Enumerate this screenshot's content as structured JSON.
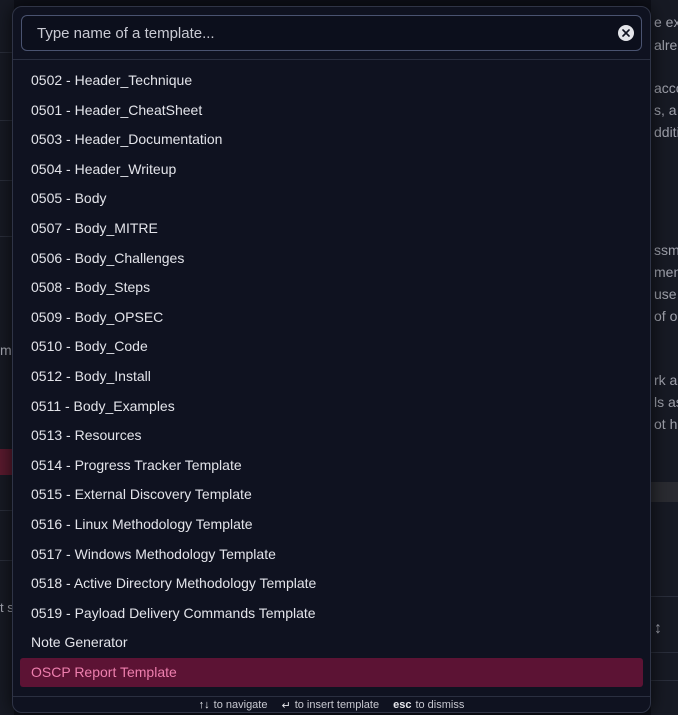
{
  "background": {
    "left_text_m": "m",
    "left_text_t": "t s",
    "right_fragments": [
      "e exp",
      "alrea",
      "acco",
      "s, a",
      "dditi",
      "ssme",
      "men",
      "use",
      "of o",
      "rk ar",
      "ls as",
      "ot ha"
    ]
  },
  "search": {
    "placeholder": "Type name of a template...",
    "value": ""
  },
  "templates": [
    "0502 - Header_Technique",
    "0501 - Header_CheatSheet",
    "0503 - Header_Documentation",
    "0504 - Header_Writeup",
    "0505 - Body",
    "0507 - Body_MITRE",
    "0506 - Body_Challenges",
    "0508 - Body_Steps",
    "0509 - Body_OPSEC",
    "0510 - Body_Code",
    "0512 - Body_Install",
    "0511 - Body_Examples",
    "0513 - Resources",
    "0514 - Progress Tracker Template",
    "0515 - External Discovery Template",
    "0516 - Linux Methodology Template",
    "0517 - Windows Methodology Template",
    "0518 - Active Directory Methodology Template",
    "0519 - Payload Delivery Commands Template",
    "Note Generator",
    "OSCP Report Template"
  ],
  "selected_index": 20,
  "footer": {
    "navigate_key": "↑↓",
    "navigate_label": "to navigate",
    "insert_key": "↵",
    "insert_label": "to insert template",
    "dismiss_key": "esc",
    "dismiss_label": "to dismiss"
  },
  "colors": {
    "selected_bg": "#5c1334",
    "selected_text": "#ee7fae",
    "modal_bg": "#0f1220"
  }
}
